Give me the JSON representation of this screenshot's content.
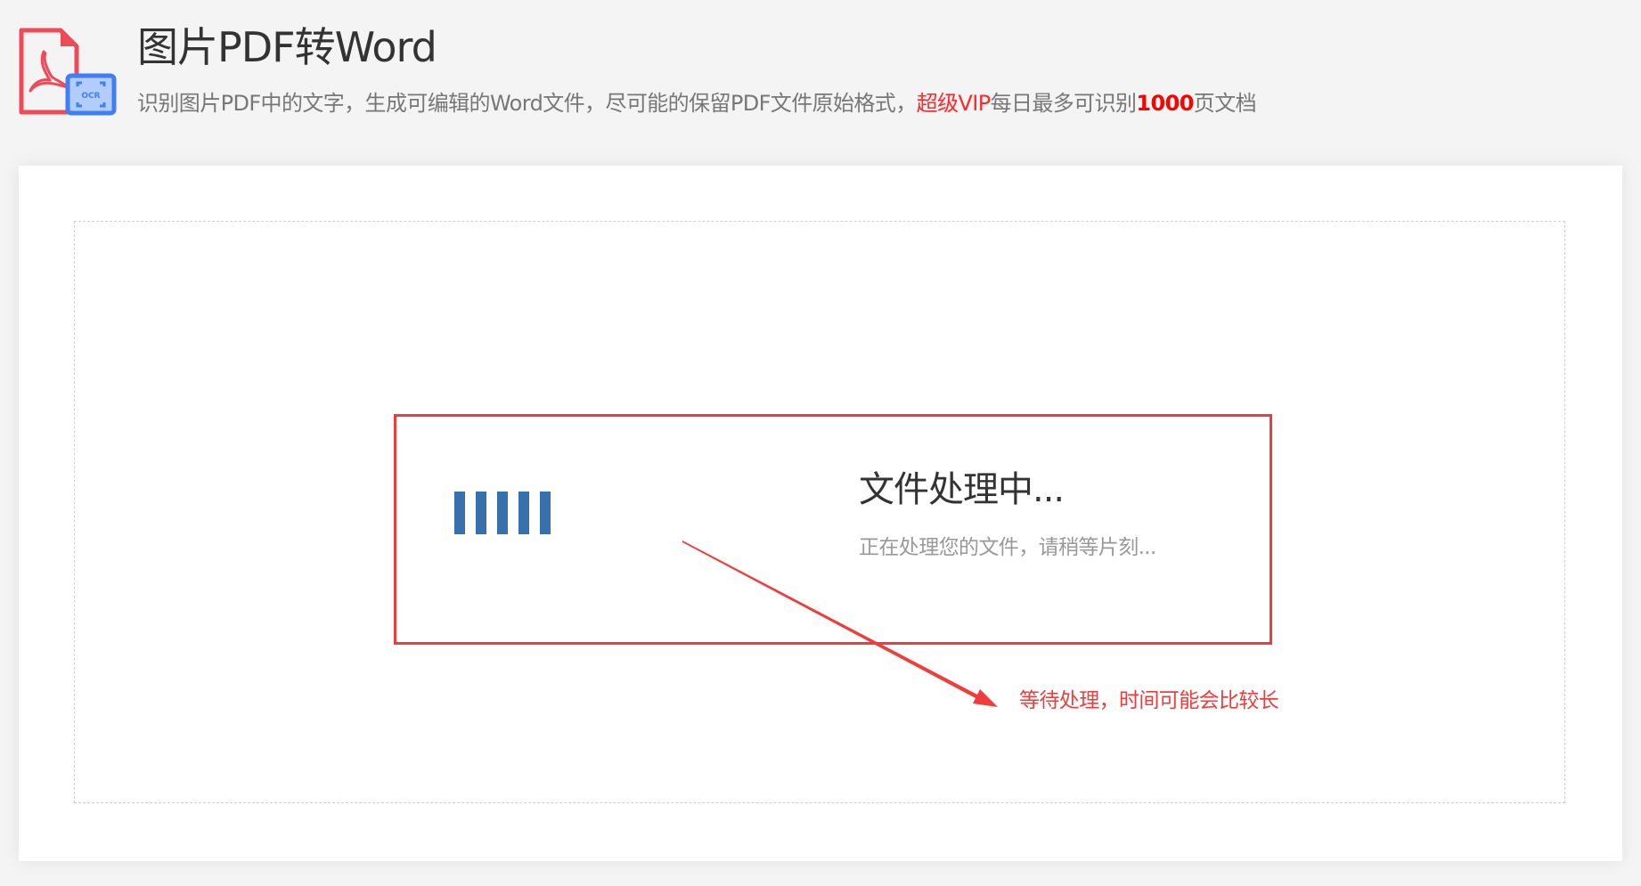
{
  "header": {
    "title": "图片PDF转Word",
    "subtitle_parts": {
      "p1": "识别图片PDF中的文字，生成可编辑的Word文件，尽可能的保留PDF文件原始格式，",
      "p2": "超级VIP",
      "p3": "每日最多可识别",
      "p4": "1000",
      "p5": "页文档"
    },
    "logo": {
      "doc_icon": "pdf-file-icon",
      "badge_icon": "ocr-scan-icon",
      "badge_text": "OCR"
    }
  },
  "processing": {
    "title": "文件处理中...",
    "subtitle": "正在处理您的文件，请稍等片刻...",
    "loader_icon": "loading-bars-icon",
    "loader_bar_count": 5
  },
  "annotation": {
    "text": "等待处理，时间可能会比较长",
    "arrow_icon": "arrow-icon"
  },
  "colors": {
    "accent_red": "#f23c3c",
    "vip_red": "#ff2a2a",
    "loader_blue": "#3771ad",
    "pdf_red": "#ef4b56",
    "ocr_blue": "#3f7ef5",
    "ocr_fill": "#b3cdfb"
  }
}
